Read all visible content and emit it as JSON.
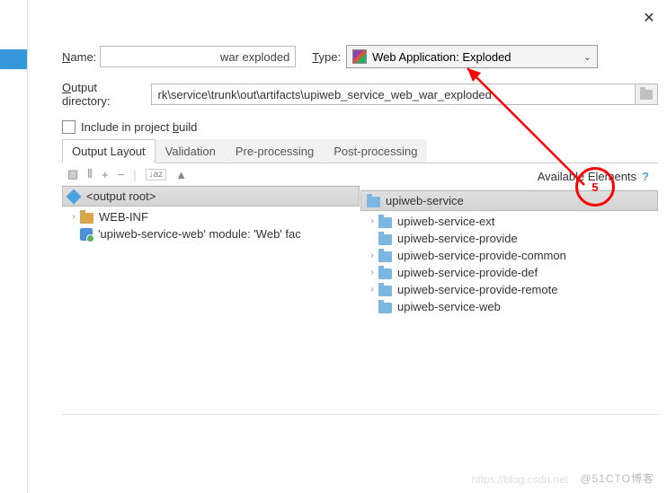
{
  "labels": {
    "name": "Name:",
    "type": "Type:",
    "output_dir": "Output directory:",
    "include_build": "Include in project build"
  },
  "fields": {
    "name_value": "war exploded",
    "type_value": "Web Application: Exploded",
    "output_dir_value": "rk\\service\\trunk\\out\\artifacts\\upiweb_service_web_war_exploded"
  },
  "tabs": {
    "t1": "Output Layout",
    "t2": "Validation",
    "t3": "Pre-processing",
    "t4": "Post-processing"
  },
  "toolbar": {
    "add": "+",
    "remove": "−",
    "sort": "↓az",
    "up": "▲"
  },
  "left_tree": {
    "root": "<output root>",
    "webinf": "WEB-INF",
    "module": "'upiweb-service-web' module: 'Web' fac"
  },
  "right": {
    "header": "Available Elements",
    "qmark": "?",
    "root": "upiweb-service",
    "items": [
      "upiweb-service-ext",
      "upiweb-service-provide",
      "upiweb-service-provide-common",
      "upiweb-service-provide-def",
      "upiweb-service-provide-remote",
      "upiweb-service-web"
    ]
  },
  "annotation": {
    "step": "5"
  },
  "watermarks": {
    "w1": "https://blog.csdn.net",
    "w2": "@51CTO博客"
  }
}
